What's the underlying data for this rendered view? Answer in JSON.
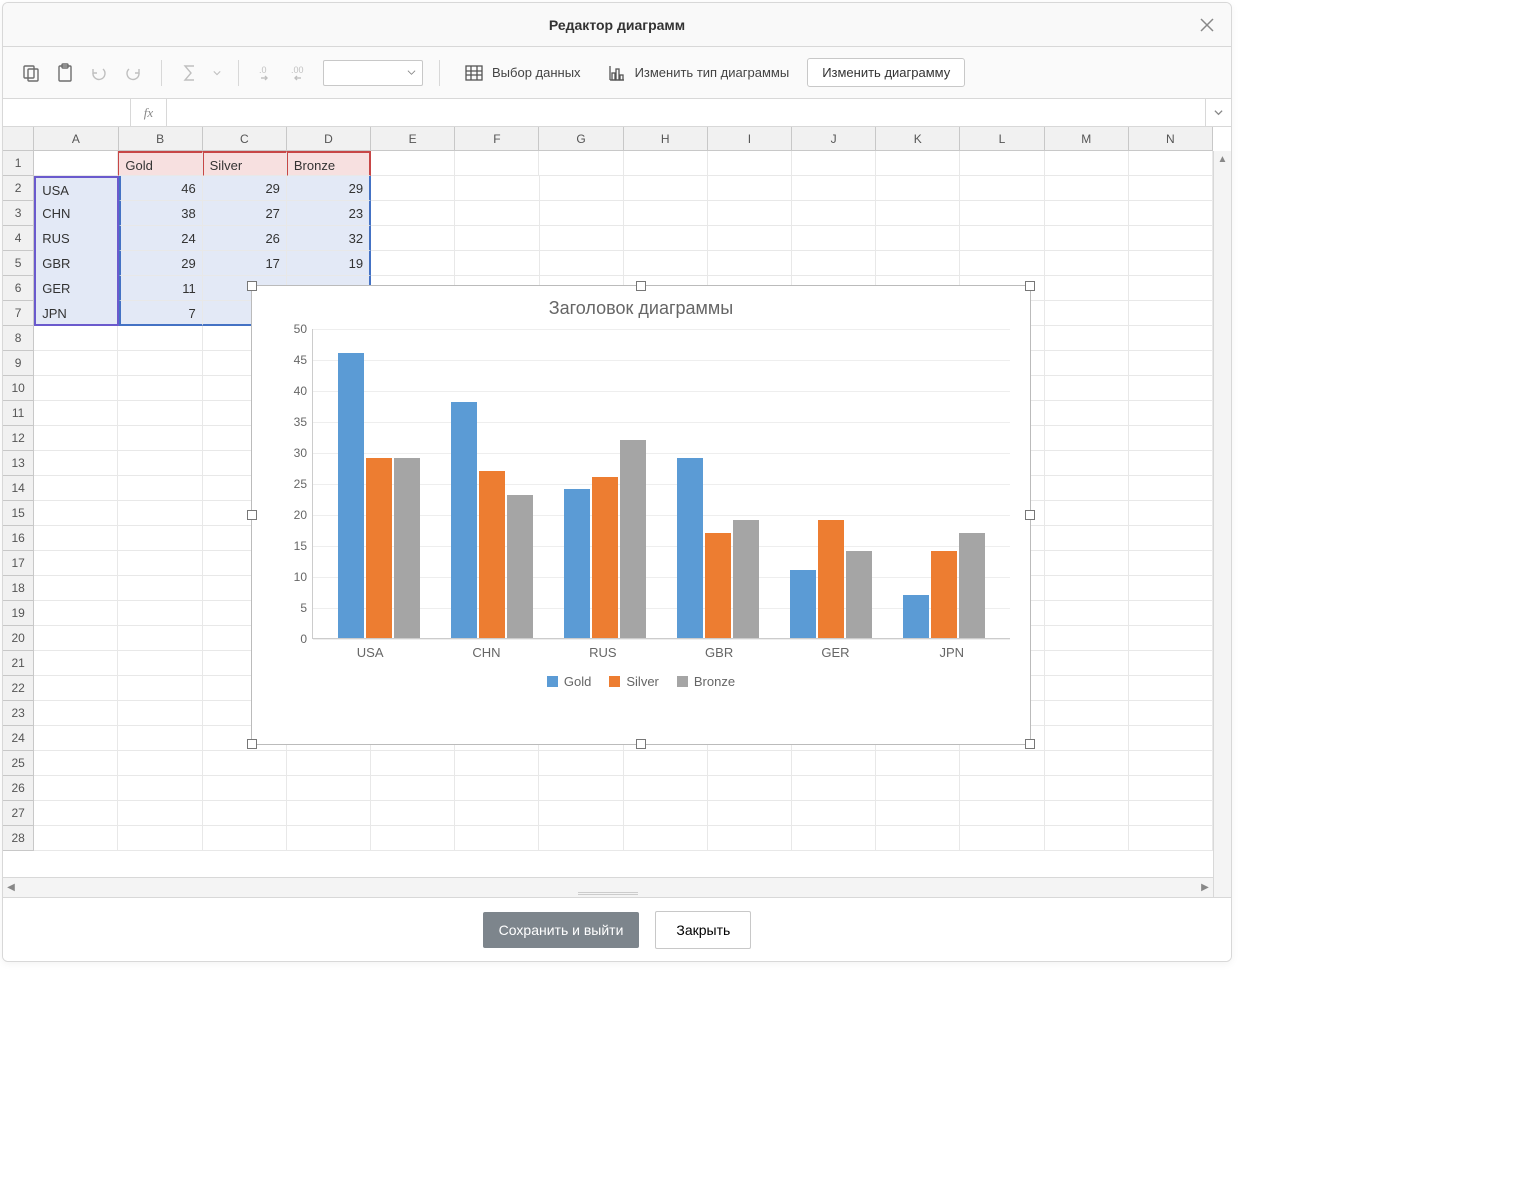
{
  "window": {
    "title": "Редактор диаграмм"
  },
  "toolbar": {
    "select_data": "Выбор данных",
    "change_type": "Изменить тип диаграммы",
    "edit_chart": "Изменить диаграмму"
  },
  "formula_bar": {
    "fx": "fx"
  },
  "columns": [
    "A",
    "B",
    "C",
    "D",
    "E",
    "F",
    "G",
    "H",
    "I",
    "J",
    "K",
    "L",
    "M",
    "N"
  ],
  "row_numbers": [
    1,
    2,
    3,
    4,
    5,
    6,
    7,
    8,
    9,
    10,
    11,
    12,
    13,
    14,
    15,
    16,
    17,
    18,
    19,
    20,
    21,
    22,
    23,
    24,
    25,
    26,
    27,
    28
  ],
  "sheet": {
    "headers": [
      "Gold",
      "Silver",
      "Bronze"
    ],
    "rows": [
      {
        "label": "USA",
        "vals": [
          46,
          29,
          29
        ]
      },
      {
        "label": "CHN",
        "vals": [
          38,
          27,
          23
        ]
      },
      {
        "label": "RUS",
        "vals": [
          24,
          26,
          32
        ]
      },
      {
        "label": "GBR",
        "vals": [
          29,
          17,
          19
        ]
      },
      {
        "label": "GER",
        "vals": [
          11,
          "",
          ""
        ]
      },
      {
        "label": "JPN",
        "vals": [
          7,
          "",
          ""
        ]
      }
    ]
  },
  "chart_data": {
    "type": "bar",
    "title": "Заголовок диаграммы",
    "categories": [
      "USA",
      "CHN",
      "RUS",
      "GBR",
      "GER",
      "JPN"
    ],
    "series": [
      {
        "name": "Gold",
        "color": "#5b9bd5",
        "values": [
          46,
          38,
          24,
          29,
          11,
          7
        ]
      },
      {
        "name": "Silver",
        "color": "#ed7d31",
        "values": [
          29,
          27,
          26,
          17,
          19,
          14
        ]
      },
      {
        "name": "Bronze",
        "color": "#a5a5a5",
        "values": [
          29,
          23,
          32,
          19,
          14,
          17
        ]
      }
    ],
    "yticks": [
      0,
      5,
      10,
      15,
      20,
      25,
      30,
      35,
      40,
      45,
      50
    ],
    "ylim": [
      0,
      50
    ],
    "xlabel": "",
    "ylabel": ""
  },
  "footer": {
    "save": "Сохранить и выйти",
    "close": "Закрыть"
  }
}
